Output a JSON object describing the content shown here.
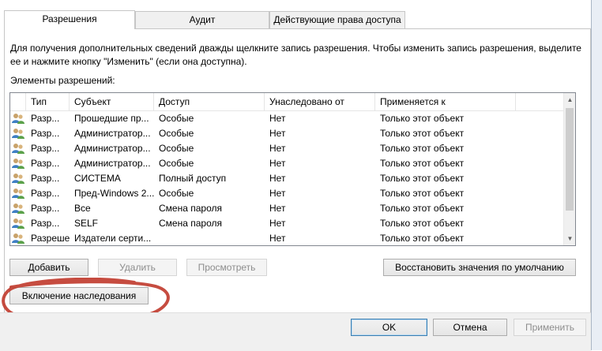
{
  "tabs": [
    {
      "label": "Разрешения",
      "active": true
    },
    {
      "label": "Аудит",
      "active": false
    },
    {
      "label": "Действующие права доступа",
      "active": false
    }
  ],
  "description": "Для получения дополнительных сведений дважды щелкните запись разрешения. Чтобы изменить запись разрешения, выделите ее и нажмите кнопку \"Изменить\" (если она доступна).",
  "group_label": "Элементы разрешений:",
  "list": {
    "columns": [
      "Тип",
      "Субъект",
      "Доступ",
      "Унаследовано от",
      "Применяется к"
    ],
    "rows": [
      [
        "Разр...",
        "Прошедшие пр...",
        "Особые",
        "Нет",
        "Только этот объект"
      ],
      [
        "Разр...",
        "Администратор...",
        "Особые",
        "Нет",
        "Только этот объект"
      ],
      [
        "Разр...",
        "Администратор...",
        "Особые",
        "Нет",
        "Только этот объект"
      ],
      [
        "Разр...",
        "Администратор...",
        "Особые",
        "Нет",
        "Только этот объект"
      ],
      [
        "Разр...",
        "СИСТЕМА",
        "Полный доступ",
        "Нет",
        "Только этот объект"
      ],
      [
        "Разр...",
        "Пред-Windows 2...",
        "Особые",
        "Нет",
        "Только этот объект"
      ],
      [
        "Разр...",
        "Все",
        "Смена пароля",
        "Нет",
        "Только этот объект"
      ],
      [
        "Разр...",
        "SELF",
        "Смена пароля",
        "Нет",
        "Только этот объект"
      ],
      [
        "Разрешения",
        "Издатели серти...",
        "",
        "Нет",
        "Только этот объект"
      ]
    ],
    "scroll_up_icon": "arrow-up-icon",
    "scroll_down_icon": "arrow-down-icon"
  },
  "buttons": {
    "add": "Добавить",
    "remove": "Удалить",
    "view": "Просмотреть",
    "restore_defaults": "Восстановить значения по умолчанию",
    "enable_inheritance": "Включение наследования"
  },
  "dialog": {
    "ok": "OK",
    "cancel": "Отмена",
    "apply": "Применить"
  },
  "colors": {
    "annotation": "#c0392b",
    "default_button_border": "#3c7fb1"
  }
}
